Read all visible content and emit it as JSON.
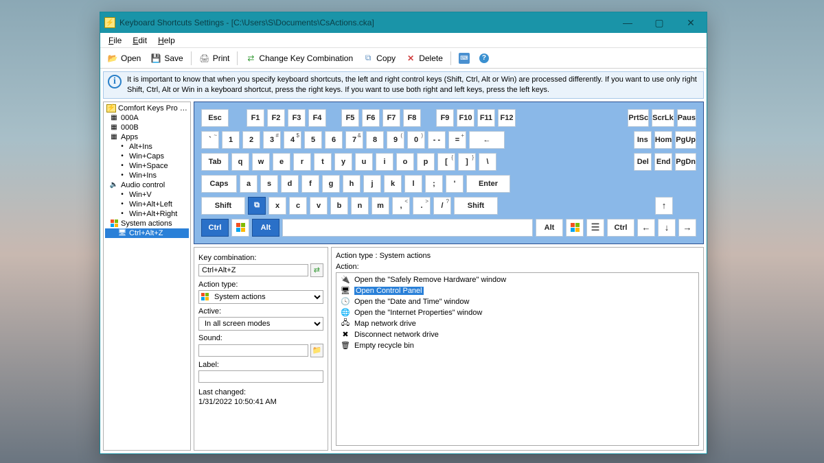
{
  "window": {
    "title": "Keyboard Shortcuts Settings - [C:\\Users\\S\\Documents\\CsActions.cka]"
  },
  "menu": {
    "file": "File",
    "edit": "Edit",
    "help": "Help"
  },
  "toolbar": {
    "open": "Open",
    "save": "Save",
    "print": "Print",
    "change": "Change Key Combination",
    "copy": "Copy",
    "delete": "Delete"
  },
  "info": "It is important to know that when you specify keyboard shortcuts, the left and right control keys (Shift, Ctrl, Alt or Win) are processed differently. If you want to use only right Shift, Ctrl, Alt or Win in a keyboard shortcut, press the right keys. If you want to use both right and left keys, press the left keys.",
  "tree": {
    "root": "Comfort Keys Pro actions",
    "groups": [
      {
        "label": "000A",
        "items": []
      },
      {
        "label": "000B",
        "items": []
      },
      {
        "label": "Apps",
        "items": [
          "Alt+Ins",
          "Win+Caps",
          "Win+Space",
          "Win+Ins"
        ]
      },
      {
        "label": "Audio control",
        "items": [
          "Win+V",
          "Win+Alt+Left",
          "Win+Alt+Right"
        ]
      },
      {
        "label": "System actions",
        "items": [
          "Ctrl+Alt+Z"
        ]
      }
    ],
    "selected": "Ctrl+Alt+Z"
  },
  "keys": {
    "esc": "Esc",
    "frow": [
      "F1",
      "F2",
      "F3",
      "F4",
      "F5",
      "F6",
      "F7",
      "F8",
      "F9",
      "F10",
      "F11",
      "F12"
    ],
    "sys": [
      "PrtSc",
      "ScrLk",
      "Paus"
    ],
    "num_row": [
      {
        "k": "`",
        "s": "~"
      },
      {
        "k": "1"
      },
      {
        "k": "2"
      },
      {
        "k": "3",
        "s": "#"
      },
      {
        "k": "4",
        "s": "$"
      },
      {
        "k": "5"
      },
      {
        "k": "6"
      },
      {
        "k": "7",
        "s": "&"
      },
      {
        "k": "8"
      },
      {
        "k": "9",
        "s": "("
      },
      {
        "k": "0",
        "s": ")"
      },
      {
        "k": "- -"
      },
      {
        "k": "=",
        "s": "+"
      }
    ],
    "back": "←",
    "nav1": [
      "Ins",
      "Hom",
      "PgUp"
    ],
    "tab": "Tab",
    "qrow": [
      {
        "k": "q"
      },
      {
        "k": "w"
      },
      {
        "k": "e"
      },
      {
        "k": "r"
      },
      {
        "k": "t"
      },
      {
        "k": "y"
      },
      {
        "k": "u"
      },
      {
        "k": "i"
      },
      {
        "k": "o"
      },
      {
        "k": "p"
      },
      {
        "k": "[",
        "s": "{"
      },
      {
        "k": "]",
        "s": "}"
      },
      {
        "k": "\\"
      }
    ],
    "nav2": [
      "Del",
      "End",
      "PgDn"
    ],
    "caps": "Caps",
    "arow": [
      {
        "k": "a"
      },
      {
        "k": "s"
      },
      {
        "k": "d"
      },
      {
        "k": "f"
      },
      {
        "k": "g"
      },
      {
        "k": "h"
      },
      {
        "k": "j"
      },
      {
        "k": "k"
      },
      {
        "k": "l"
      },
      {
        "k": ";"
      },
      {
        "k": "'"
      }
    ],
    "enter": "Enter",
    "shift": "Shift",
    "zrow": [
      {
        "k": "x"
      },
      {
        "k": "c"
      },
      {
        "k": "v"
      },
      {
        "k": "b"
      },
      {
        "k": "n"
      },
      {
        "k": "m"
      },
      {
        "k": ",",
        "s": "<"
      },
      {
        "k": ".",
        "s": ">"
      },
      {
        "k": "/",
        "s": "?"
      }
    ],
    "ctrl": "Ctrl",
    "alt": "Alt",
    "arrows": {
      "up": "↑",
      "left": "←",
      "down": "↓",
      "right": "→"
    }
  },
  "form": {
    "key_combination_label": "Key combination:",
    "key_combination_value": "Ctrl+Alt+Z",
    "action_type_label": "Action type:",
    "action_type_value": "System actions",
    "active_label": "Active:",
    "active_value": "In all screen modes",
    "sound_label": "Sound:",
    "sound_value": "",
    "label_label": "Label:",
    "label_value": "",
    "last_changed_label": "Last changed:",
    "last_changed_value": "1/31/2022 10:50:41 AM"
  },
  "actions_panel": {
    "header": "Action type : System actions",
    "action_label": "Action:",
    "items": [
      "Open the \"Safely Remove Hardware\" window",
      "Open Control Panel",
      "Open the \"Date and Time\" window",
      "Open the \"Internet Properties\" window",
      "Map network drive",
      "Disconnect network drive",
      "Empty recycle bin"
    ],
    "selected_index": 1
  }
}
